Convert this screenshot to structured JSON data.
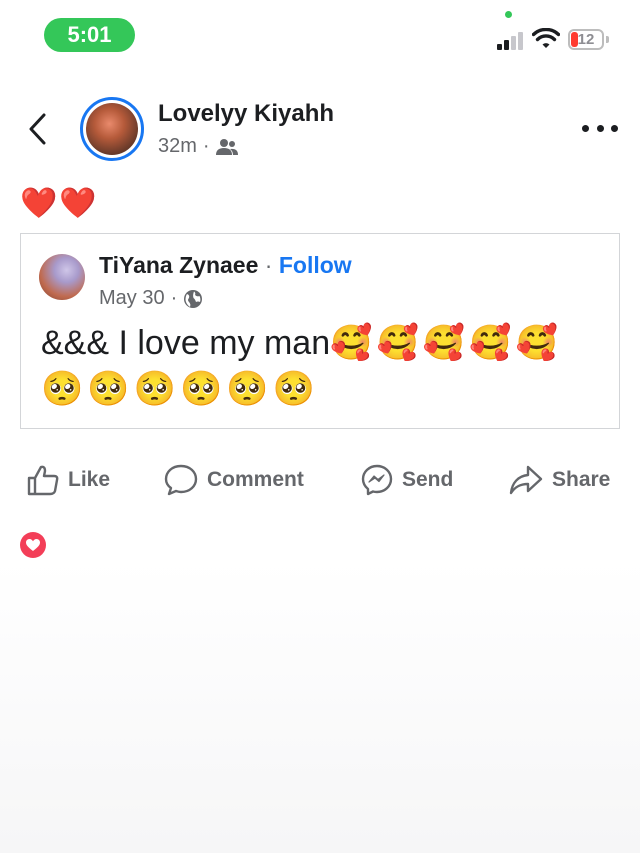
{
  "status_bar": {
    "time": "5:01",
    "battery": "12",
    "accent_color": "#34c759",
    "battery_color": "#ff3b30"
  },
  "post": {
    "author": "Lovelyy Kiyahh",
    "time": "32m",
    "dot": "·",
    "audience_icon": "friends-icon",
    "text": "❤️❤️"
  },
  "shared_post": {
    "author": "TiYana Zynaee",
    "separator": " · ",
    "follow_label": "Follow",
    "date": "May 30",
    "dot": "·",
    "audience_icon": "globe-icon",
    "text": "&&& I love my man",
    "emojis_line1": "🥰🥰🥰🥰🥰",
    "emojis_line2": "🥺🥺🥺🥺🥺🥺"
  },
  "actions": {
    "like": "Like",
    "comment": "Comment",
    "send": "Send",
    "share": "Share"
  },
  "reactions": {
    "icon": "love-reaction-icon",
    "color": "#f33e58"
  },
  "colors": {
    "link_blue": "#1877f2",
    "secondary_text": "#65676b"
  }
}
